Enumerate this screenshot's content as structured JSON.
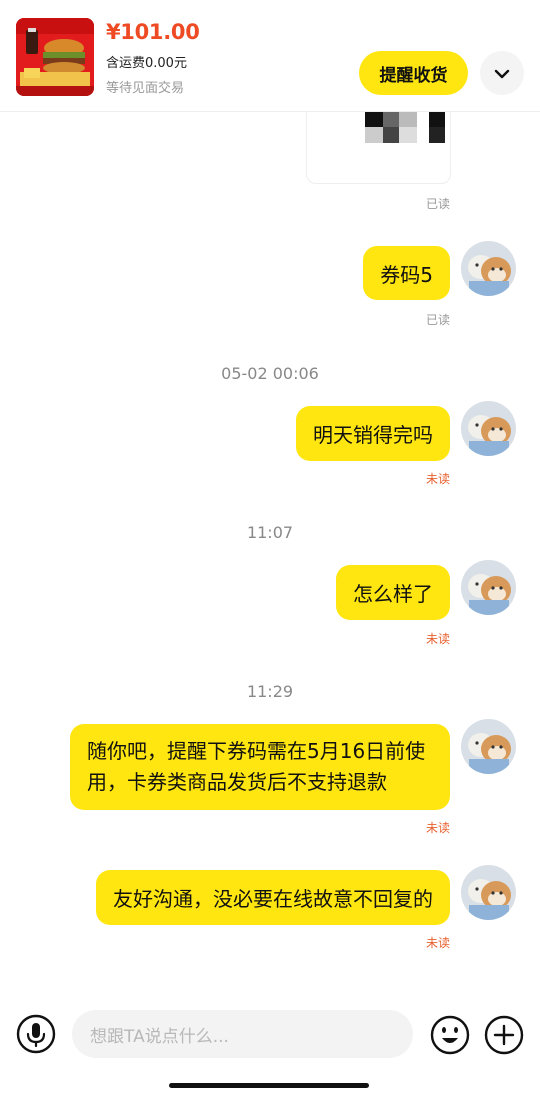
{
  "header": {
    "price": "¥101.00",
    "shipping": "含运费0.00元",
    "status": "等待见面交易",
    "remind_button": "提醒收货",
    "expand_icon": "chevron-down-icon"
  },
  "messages": [
    {
      "status": "已读"
    },
    {
      "text": "券码5",
      "status": "已读"
    },
    {
      "time": "05-02 00:06"
    },
    {
      "text": "明天销得完吗",
      "status": "未读"
    },
    {
      "time": "11:07"
    },
    {
      "text": "怎么样了",
      "status": "未读"
    },
    {
      "time": "11:29"
    },
    {
      "text": "随你吧，提醒下券码需在5月16日前使用，卡券类商品发货后不支持退款",
      "status": "未读"
    },
    {
      "text": "友好沟通，没必要在线故意不回复的",
      "status": "未读"
    }
  ],
  "input": {
    "placeholder": "想跟TA说点什么..."
  },
  "colors": {
    "accent": "#ffe611",
    "price": "#ee4a23",
    "unread": "#e8602d"
  },
  "icons": [
    "microphone-icon",
    "emoji-icon",
    "plus-icon"
  ]
}
